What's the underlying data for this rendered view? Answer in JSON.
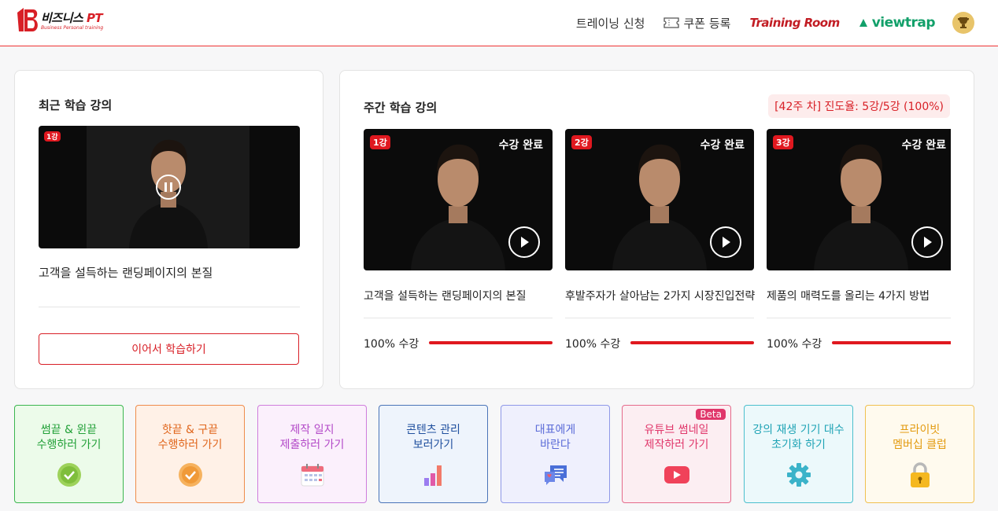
{
  "header": {
    "logo_name": "비즈니스",
    "logo_pt": "PT",
    "logo_sub": "Business Personal training",
    "nav": {
      "training_apply": "트레이닝 신청",
      "coupon": "쿠폰 등록",
      "training_room": "Training Room",
      "viewtrap": "viewtrap"
    }
  },
  "recent": {
    "title": "최근 학습 강의",
    "badge": "1강",
    "lecture_title": "고객을 설득하는 랜딩페이지의 본질",
    "continue_label": "이어서 학습하기"
  },
  "weekly": {
    "title": "주간 학습 강의",
    "progress": "[42주 차] 진도율: 5강/5강 (100%)",
    "lectures": [
      {
        "badge": "1강",
        "status": "수강 완료",
        "title": "고객을 설득하는 랜딩페이지의 본질",
        "progress_label": "100% 수강",
        "progress": 1.0
      },
      {
        "badge": "2강",
        "status": "수강 완료",
        "title": "후발주자가 살아남는 2가지 시장진입전략",
        "progress_label": "100% 수강",
        "progress": 1.0
      },
      {
        "badge": "3강",
        "status": "수강 완료",
        "title": "제품의 매력도를 올리는 4가지 방법",
        "progress_label": "100% 수강",
        "progress": 1.0
      }
    ]
  },
  "quick": [
    {
      "line1": "썸끝 & 윈끝",
      "line2": "수행하러 가기",
      "icon": "check-circle-icon",
      "color": "#22a038",
      "bg": "#ecfbea",
      "border": "#3cb650"
    },
    {
      "line1": "핫끝 & 구끝",
      "line2": "수행하러 가기",
      "icon": "check-circle-orange-icon",
      "color": "#e0661c",
      "bg": "#fff1e7",
      "border": "#ef8c4c"
    },
    {
      "line1": "제작 일지",
      "line2": "제출하러 가기",
      "icon": "calendar-icon",
      "color": "#b349c8",
      "bg": "#fbf0fc",
      "border": "#cf7ddc"
    },
    {
      "line1": "콘텐츠 관리",
      "line2": "보러가기",
      "icon": "bar-chart-icon",
      "color": "#1f4f9e",
      "bg": "#eef4fc",
      "border": "#4a74b8"
    },
    {
      "line1": "대표에게",
      "line2": "바란다",
      "icon": "chat-bubble-icon",
      "color": "#5b6bd8",
      "bg": "#eff0fd",
      "border": "#8e98e8"
    },
    {
      "line1": "유튜브 썸네일",
      "line2": "제작하러 가기",
      "icon": "youtube-icon",
      "color": "#e0366a",
      "bg": "#fceef2",
      "border": "#e56a8b",
      "beta": "Beta"
    },
    {
      "line1": "강의 재생 기기 대수",
      "line2": "초기화 하기",
      "icon": "gear-icon",
      "color": "#1ea3b5",
      "bg": "#ecf9fb",
      "border": "#4cbfcd"
    },
    {
      "line1": "프라이빗",
      "line2": "멤버십 클럽",
      "icon": "lock-icon",
      "color": "#e39b10",
      "bg": "#fffaee",
      "border": "#f0c050"
    }
  ]
}
